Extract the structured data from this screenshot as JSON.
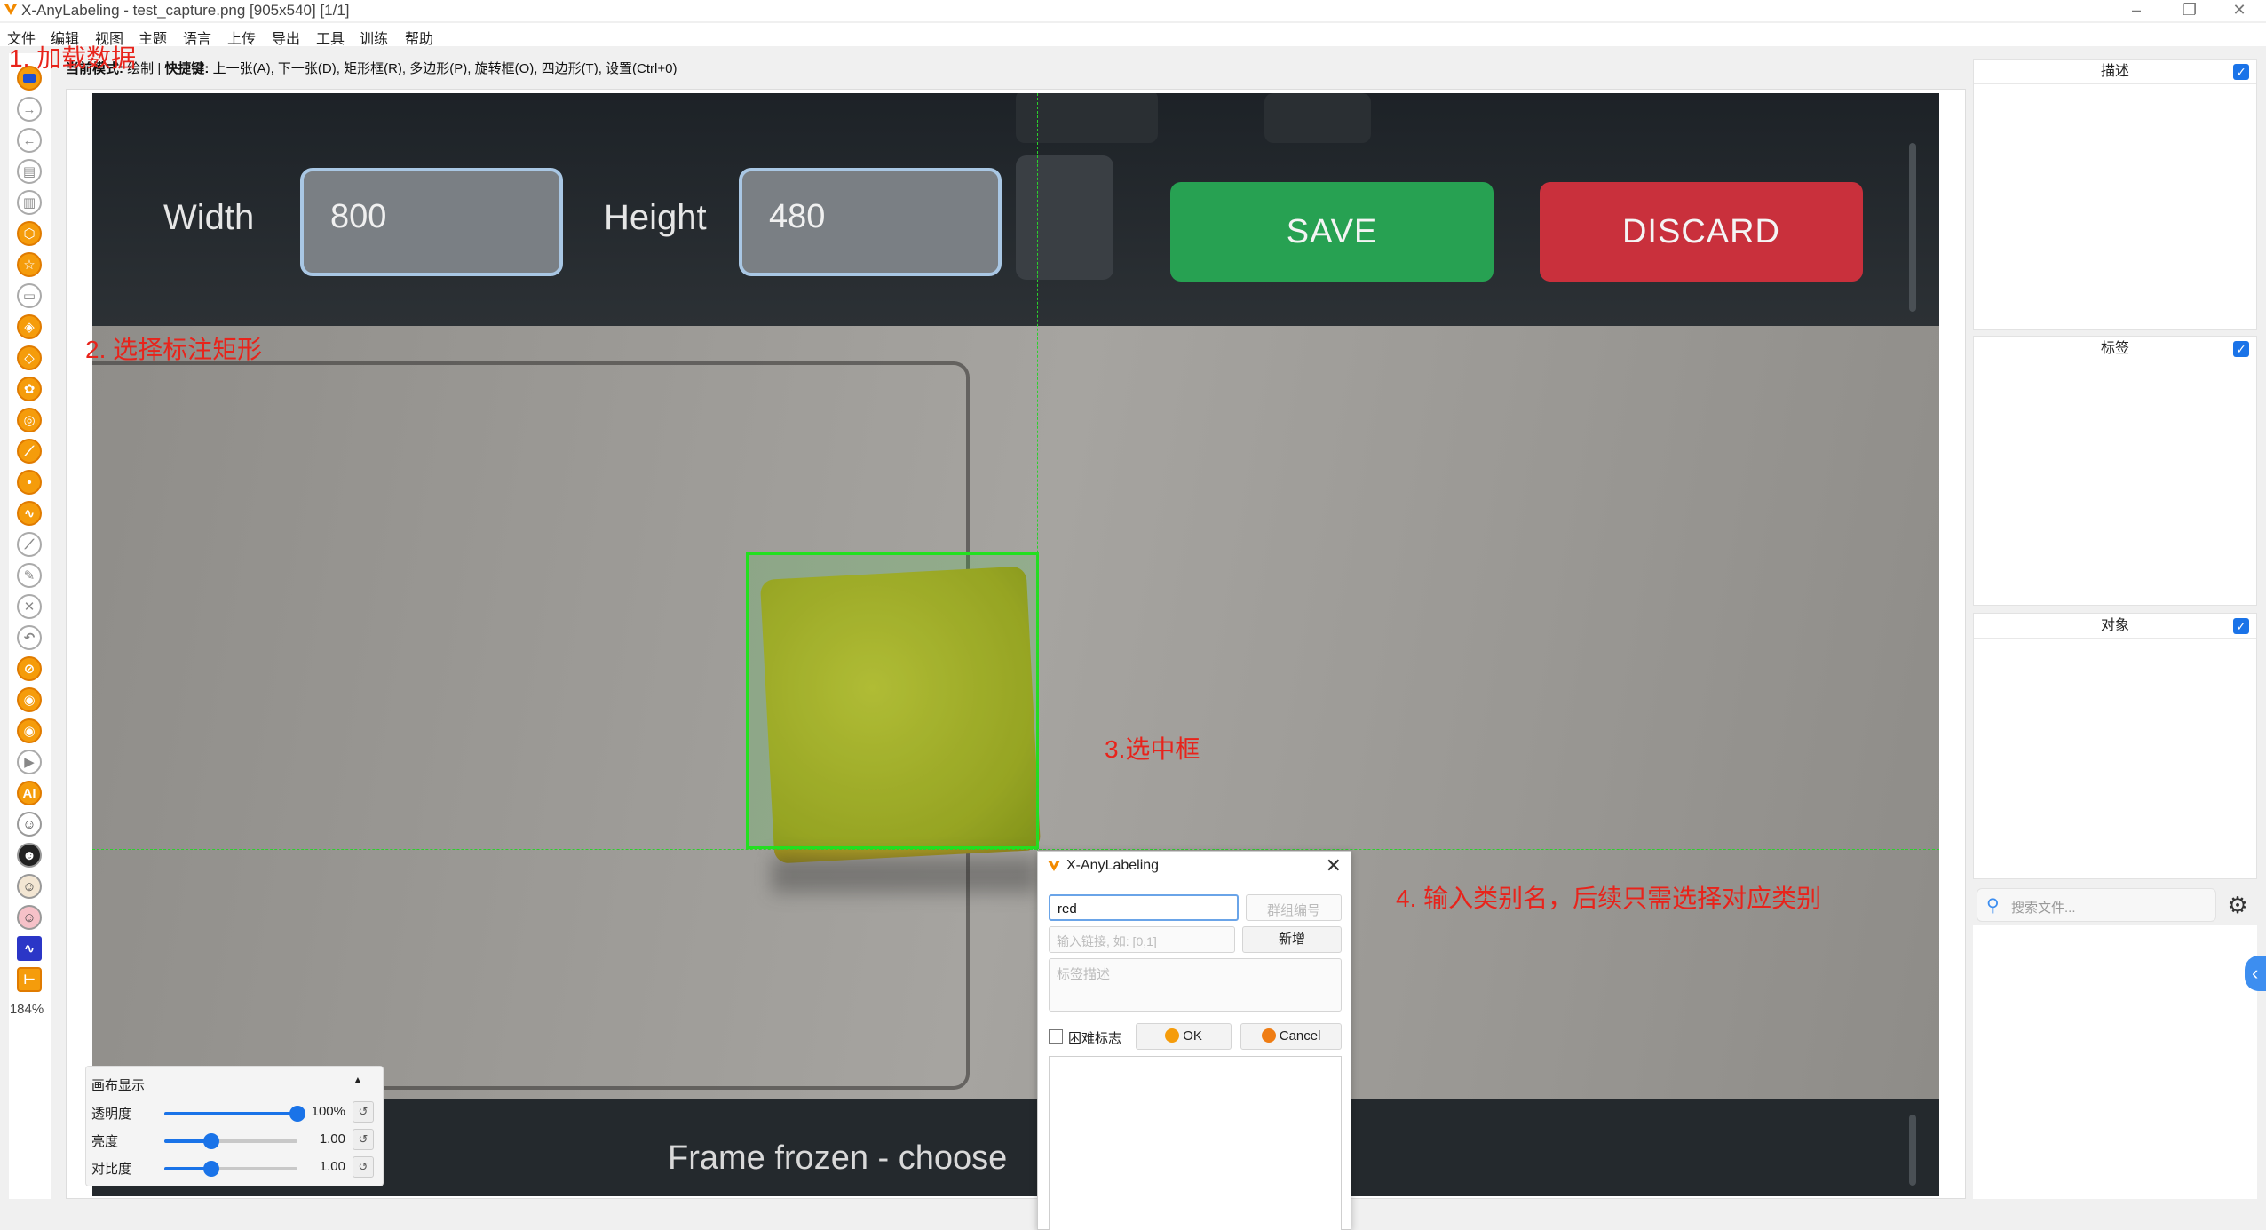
{
  "window": {
    "title": "X-AnyLabeling - test_capture.png [905x540] [1/1]"
  },
  "menu": [
    "文件",
    "编辑",
    "视图",
    "主题",
    "语言",
    "上传",
    "导出",
    "工具",
    "训练",
    "帮助"
  ],
  "mode_line": {
    "mode_label": "当前模式:",
    "mode_value": "绘制",
    "shortcut_label": "快捷键:",
    "shortcuts": "上一张(A), 下一张(D), 矩形框(R), 多边形(P), 旋转框(O), 四边形(T), 设置(Ctrl+0)"
  },
  "zoom": "184%",
  "annotations": [
    "1. 加载数据",
    "2. 选择标注矩形",
    "3.选中框",
    "4. 输入类别名，后续只需选择对应类别"
  ],
  "image": {
    "width_label": "Width",
    "width_value": "800",
    "height_label": "Height",
    "height_value": "480",
    "save_label": "SAVE",
    "discard_label": "DISCARD",
    "footer_text": "Frame frozen - choose"
  },
  "right_panel": {
    "description_title": "描述",
    "labels_title": "标签",
    "objects_title": "对象",
    "search_placeholder": "搜索文件..."
  },
  "canvas_display": {
    "title": "画布显示",
    "opacity": {
      "label": "透明度",
      "value": "100%",
      "level": 1.0
    },
    "brightness": {
      "label": "亮度",
      "value": "1.00",
      "level": 0.35
    },
    "contrast": {
      "label": "对比度",
      "value": "1.00",
      "level": 0.35
    }
  },
  "dialog": {
    "title": "X-AnyLabeling",
    "label_value": "red",
    "group_placeholder": "群组编号",
    "link_placeholder": "输入链接, 如: [0,1]",
    "add_label": "新增",
    "desc_placeholder": "标签描述",
    "difficult_label": "困难标志",
    "ok_label": "OK",
    "cancel_label": "Cancel"
  },
  "colors": {
    "accent": "#1a73e8",
    "tool_orange": "#f59c0b",
    "annotation_red": "#e8231b",
    "bbox_green": "#22e01f"
  }
}
